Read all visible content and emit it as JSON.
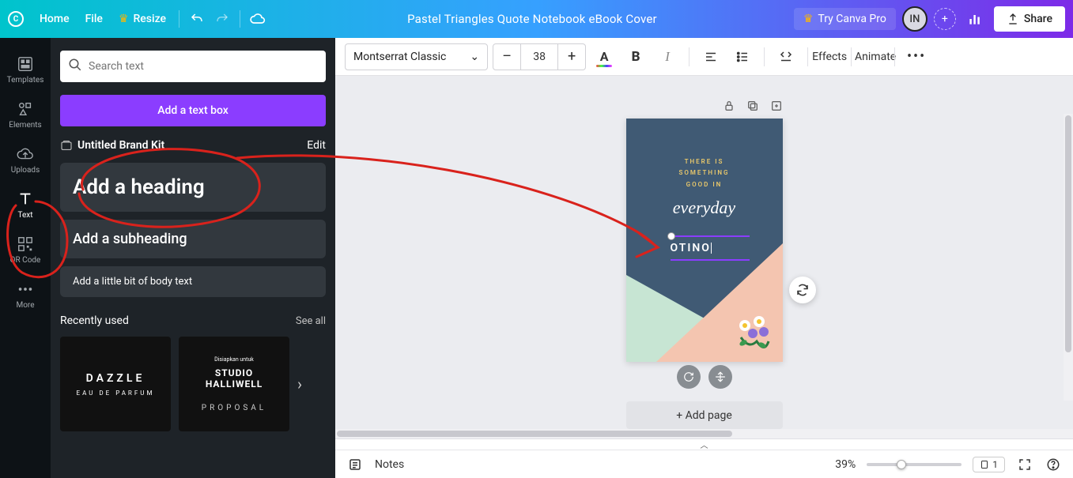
{
  "topbar": {
    "home": "Home",
    "file": "File",
    "resize": "Resize",
    "doc_title": "Pastel Triangles Quote Notebook eBook Cover",
    "try_pro": "Try Canva Pro",
    "avatar_initials": "IN",
    "share": "Share"
  },
  "rail": {
    "templates": "Templates",
    "elements": "Elements",
    "uploads": "Uploads",
    "text": "Text",
    "qrcode": "QR Code",
    "more": "More"
  },
  "panel": {
    "search_placeholder": "Search text",
    "add_text_box": "Add a text box",
    "brand_kit_label": "Untitled Brand Kit",
    "edit": "Edit",
    "heading": "Add a heading",
    "subheading": "Add a subheading",
    "body": "Add a little bit of body text",
    "recently_used": "Recently used",
    "see_all": "See all",
    "tpl1": {
      "line1": "DAZZLE",
      "line2": "EAU DE PARFUM"
    },
    "tpl2": {
      "s1": "Disiapkan untuk",
      "s2": "STUDIO\nHALLIWELL",
      "s3": "PROPOSAL"
    }
  },
  "toolbar": {
    "font": "Montserrat Classic",
    "size": "38",
    "effects": "Effects",
    "animate": "Animate"
  },
  "cover": {
    "quote_lines": "THERE IS\nSOMETHING\nGOOD IN",
    "quote_word": "everyday",
    "editing_text": "OTINO"
  },
  "add_page": "+ Add page",
  "bottom": {
    "notes": "Notes",
    "zoom": "39%",
    "page": "1"
  }
}
